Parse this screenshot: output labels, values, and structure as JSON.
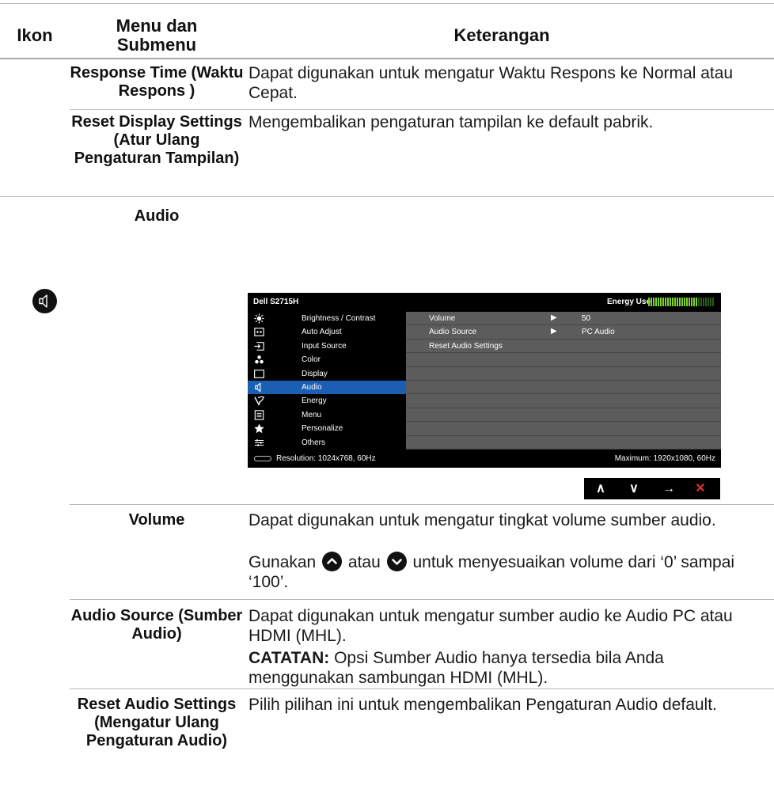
{
  "header": {
    "col_icon": "Ikon",
    "col_menu": "Menu dan Submenu",
    "col_desc": "Keterangan"
  },
  "rows": {
    "response_time": {
      "menu": "Response Time (Waktu Respons )",
      "desc": "Dapat digunakan untuk mengatur Waktu Respons ke Normal atau Cepat."
    },
    "reset_display": {
      "menu": "Reset Display Settings (Atur Ulang Pengaturan Tampilan)",
      "desc": "Mengembalikan pengaturan tampilan ke default pabrik."
    },
    "audio": {
      "icon": "speaker-icon",
      "menu": "Audio"
    },
    "volume": {
      "menu": "Volume",
      "desc1": "Dapat digunakan untuk mengatur tingkat volume sumber audio.",
      "desc2_a": "Gunakan",
      "desc2_b": "atau",
      "desc2_c": "untuk menyesuaikan volume dari ‘0’ sampai ‘100’."
    },
    "audio_source": {
      "menu": "Audio Source (Sumber Audio)",
      "desc1": "Dapat digunakan untuk mengatur sumber audio ke Audio PC atau HDMI (MHL).",
      "note_label": "CATATAN:",
      "note_text": "Opsi Sumber Audio hanya tersedia bila Anda menggunakan sambungan HDMI (MHL)."
    },
    "reset_audio": {
      "menu": "Reset Audio Settings (Mengatur Ulang Pengaturan Audio)",
      "desc": "Pilih pilihan ini untuk mengembalikan Pengaturan Audio default."
    }
  },
  "osd": {
    "model": "Dell S2715H",
    "energy_label": "Energy Use",
    "energy_level": 0.75,
    "menu_items": [
      {
        "label": "Brightness / Contrast",
        "icon": "brightness-icon"
      },
      {
        "label": "Auto Adjust",
        "icon": "auto-adjust-icon"
      },
      {
        "label": "Input Source",
        "icon": "input-source-icon"
      },
      {
        "label": "Color",
        "icon": "color-icon"
      },
      {
        "label": "Display",
        "icon": "display-icon"
      },
      {
        "label": "Audio",
        "icon": "audio-icon"
      },
      {
        "label": "Energy",
        "icon": "energy-icon"
      },
      {
        "label": "Menu",
        "icon": "menu-icon"
      },
      {
        "label": "Personalize",
        "icon": "personalize-icon"
      },
      {
        "label": "Others",
        "icon": "others-icon"
      }
    ],
    "selected_index": 5,
    "panel_rows": [
      {
        "label": "Volume",
        "arrow": "▶",
        "value": "50"
      },
      {
        "label": "Audio Source",
        "arrow": "▶",
        "value": "PC Audio"
      },
      {
        "label": "Reset Audio Settings",
        "arrow": "",
        "value": ""
      }
    ],
    "resolution": "Resolution: 1024x768, 60Hz",
    "maximum": "Maximum: 1920x1080, 60Hz",
    "nav_buttons": [
      {
        "glyph": "∧",
        "icon": "up-icon"
      },
      {
        "glyph": "∨",
        "icon": "down-icon"
      },
      {
        "glyph": "→",
        "icon": "right-arrow-icon"
      },
      {
        "glyph": "✕",
        "icon": "close-icon"
      }
    ],
    "colors": {
      "selected": "#1a5fb4",
      "energy_on": "#7fd12d",
      "close": "#e0322b"
    }
  }
}
